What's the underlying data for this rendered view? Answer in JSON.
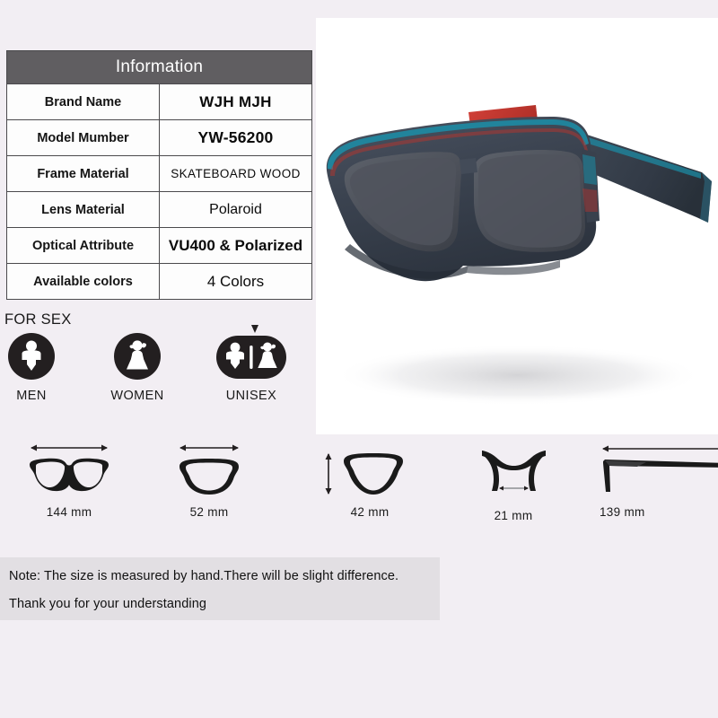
{
  "colors": {
    "page_background": "#f2eef3",
    "table_header_bg": "#605e61",
    "table_border": "#4b4a4d",
    "note_bg": "#e2dfe3",
    "icon_dark": "#231f20",
    "frame_body": "#3c4450",
    "frame_stripe_teal": "#1b8ea8",
    "frame_stripe_red": "#b8342c",
    "temple_inner_red": "#c5332c",
    "lens": "#4c5059"
  },
  "spec_table": {
    "header": "Information",
    "rows": [
      {
        "key": "Brand Name",
        "value": "WJH MJH"
      },
      {
        "key": "Model Mumber",
        "value": "YW-56200"
      },
      {
        "key": "Frame Material",
        "value": "SKATEBOARD   WOOD"
      },
      {
        "key": "Lens Material",
        "value": "Polaroid"
      },
      {
        "key": "Optical Attribute",
        "value": "VU400 & Polarized"
      },
      {
        "key": "Available colors",
        "value": "4  Colors"
      }
    ]
  },
  "for_sex": {
    "label": "FOR SEX",
    "options": [
      {
        "caption": "MEN",
        "icon": "male-figure-icon",
        "selected": false
      },
      {
        "caption": "WOMEN",
        "icon": "female-figure-icon",
        "selected": false
      },
      {
        "caption": "UNISEX",
        "icon": "unisex-figure-icon",
        "selected": true
      }
    ]
  },
  "measurements": [
    {
      "value": "144 mm",
      "icon": "full-frame-front-icon",
      "dimension": "frame-total-width"
    },
    {
      "value": "52 mm",
      "icon": "single-lens-icon",
      "dimension": "lens-width"
    },
    {
      "value": "42 mm",
      "icon": "single-lens-icon",
      "dimension": "lens-height"
    },
    {
      "value": "21 mm",
      "icon": "bridge-icon",
      "dimension": "bridge-width"
    },
    {
      "value": "139 mm",
      "icon": "temple-arm-icon",
      "dimension": "temple-length"
    }
  ],
  "note": {
    "line1": "Note: The size is measured by hand.There will be slight difference.",
    "line2": "Thank you for your understanding"
  },
  "product_photo": {
    "alt": "Dark navy skateboard wood wayfarer sunglasses with teal and red laminate stripes and dark gray polarized lenses"
  }
}
